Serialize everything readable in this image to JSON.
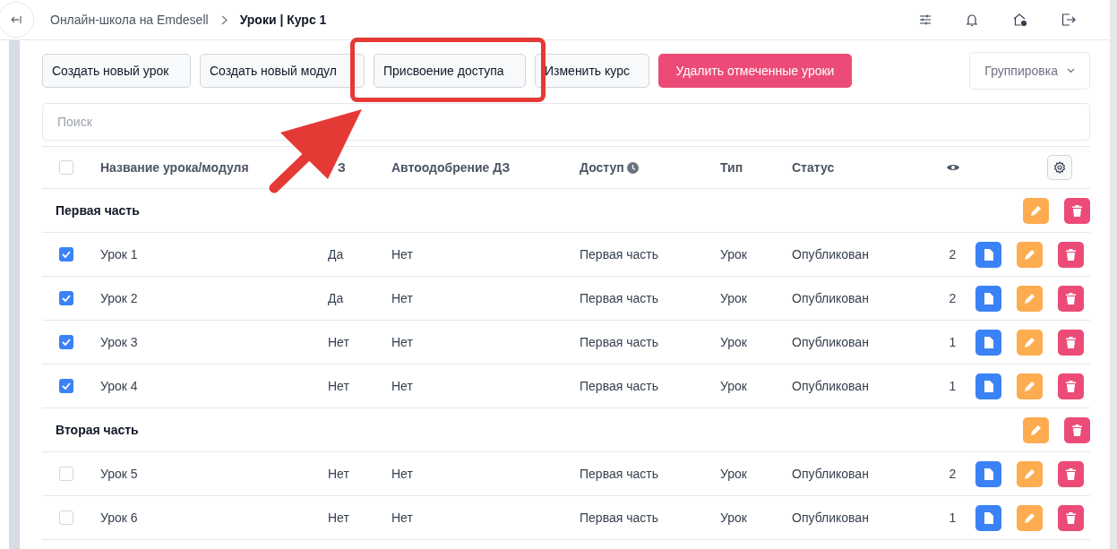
{
  "breadcrumb": [
    {
      "label": "Онлайн-школа на Emdesell",
      "current": false
    },
    {
      "label": "Уроки | Курс 1",
      "current": true
    }
  ],
  "toolbar_buttons": [
    {
      "label": "Создать новый урок",
      "kind": "plain"
    },
    {
      "label": "Создать новый модул",
      "kind": "plain"
    },
    {
      "label": "Присвоение доступа",
      "kind": "plain"
    },
    {
      "label": "Изменить курс",
      "kind": "plain"
    },
    {
      "label": "Удалить отмеченные уроки",
      "kind": "danger"
    }
  ],
  "grouping": {
    "label": "Группировка"
  },
  "search": {
    "placeholder": "Поиск"
  },
  "table": {
    "select_all": {
      "checked": false
    },
    "columns": [
      "Название урока/модуля",
      "З",
      "Автоодобрение ДЗ",
      "Доступ",
      "Тип",
      "Статус"
    ],
    "rows": [
      {
        "kind": "module",
        "title": "Первая часть"
      },
      {
        "kind": "lesson",
        "checked": true,
        "title": "Урок 1",
        "hw": "Да",
        "auto": "Нет",
        "access": "Первая часть",
        "type": "Урок",
        "status": "Опубликован",
        "views": "2"
      },
      {
        "kind": "lesson",
        "checked": true,
        "title": "Урок 2",
        "hw": "Да",
        "auto": "Нет",
        "access": "Первая часть",
        "type": "Урок",
        "status": "Опубликован",
        "views": "2"
      },
      {
        "kind": "lesson",
        "checked": true,
        "title": "Урок 3",
        "hw": "Нет",
        "auto": "Нет",
        "access": "Первая часть",
        "type": "Урок",
        "status": "Опубликован",
        "views": "1"
      },
      {
        "kind": "lesson",
        "checked": true,
        "title": "Урок 4",
        "hw": "Нет",
        "auto": "Нет",
        "access": "Первая часть",
        "type": "Урок",
        "status": "Опубликован",
        "views": "1"
      },
      {
        "kind": "module",
        "title": "Вторая часть"
      },
      {
        "kind": "lesson",
        "checked": false,
        "title": "Урок 5",
        "hw": "Нет",
        "auto": "Нет",
        "access": "Первая часть",
        "type": "Урок",
        "status": "Опубликован",
        "views": "2"
      },
      {
        "kind": "lesson",
        "checked": false,
        "title": "Урок 6",
        "hw": "Нет",
        "auto": "Нет",
        "access": "Первая часть",
        "type": "Урок",
        "status": "Опубликован",
        "views": "1"
      }
    ]
  }
}
